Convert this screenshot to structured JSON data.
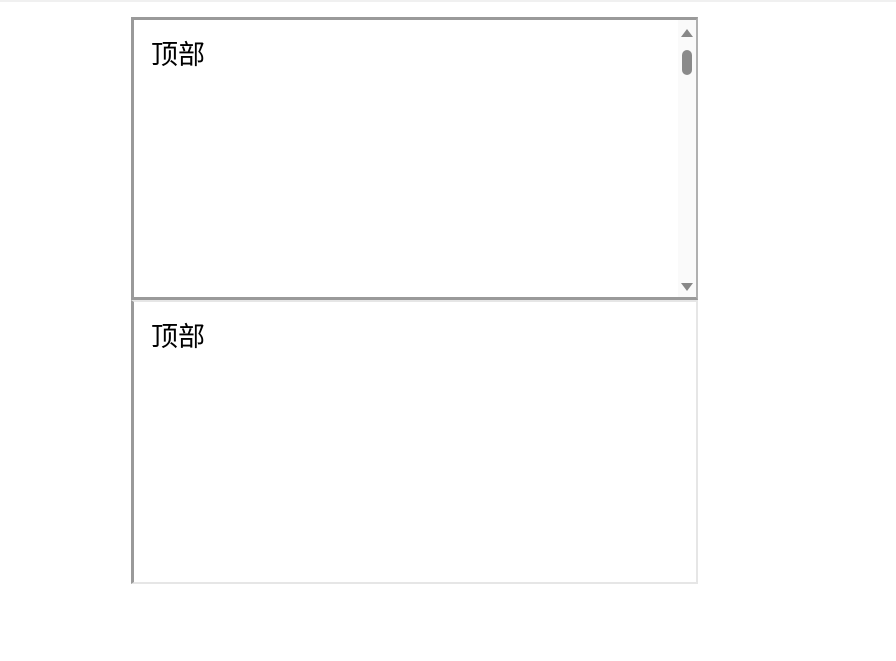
{
  "panels": [
    {
      "label": "顶部"
    },
    {
      "label": "顶部"
    }
  ],
  "scrollbar": {
    "scroll_position": 0
  }
}
